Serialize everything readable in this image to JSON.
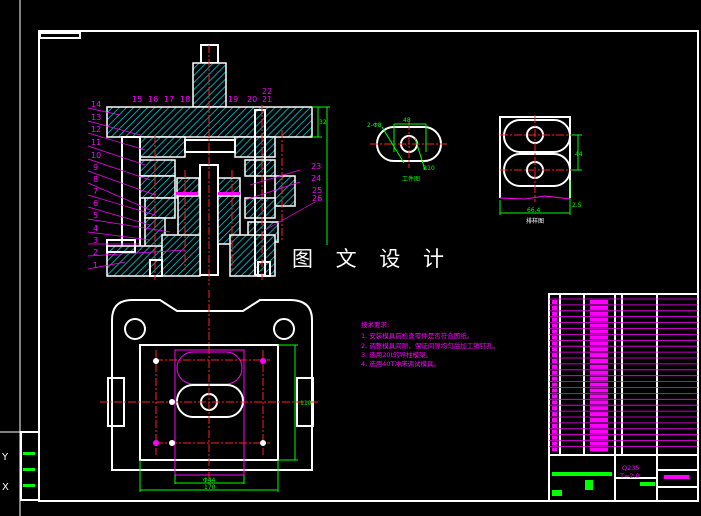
{
  "drawing": {
    "watermark": "图 文 设 计",
    "section_view": {
      "left_labels": [
        "14",
        "13",
        "12",
        "11",
        "10",
        "9",
        "8",
        "7",
        "6",
        "5",
        "4",
        "3",
        "2",
        "1"
      ],
      "top_labels": [
        "15",
        "16",
        "17",
        "18",
        "19",
        "20",
        "21",
        "22"
      ],
      "right_labels": [
        "23",
        "24",
        "25",
        "26"
      ],
      "height_dim": "32"
    },
    "workpiece_view": {
      "title": "工件图",
      "dim_top": "48",
      "dim_left": "2-Φ8",
      "dim_right": "R10"
    },
    "layout_view": {
      "title": "排样图",
      "dim_bottom": "66.4",
      "dim_right": "44",
      "dim_small": "2.5"
    },
    "plan_view": {
      "dim_phi": "Φ44",
      "dim_width": "170",
      "dim_height": "110"
    },
    "technical_requirements": {
      "title": "技术要求:",
      "items": [
        "1. 安装模具前检查零件是否符合图纸。",
        "2. 调整模具间隙，保证间隙均匀后加工销钉孔。",
        "3. 选用20t的导柱模架。",
        "4. 选用40T冲床调试模具。"
      ]
    },
    "title_block": {
      "material": "Q235",
      "thickness": "T=2.0"
    }
  },
  "colors": {
    "background": "#000000",
    "outline": "#ffffff",
    "centerline": "#ff2020",
    "dimension": "#00ff00",
    "label": "#ff00ff",
    "hatch": "#00ffff"
  }
}
